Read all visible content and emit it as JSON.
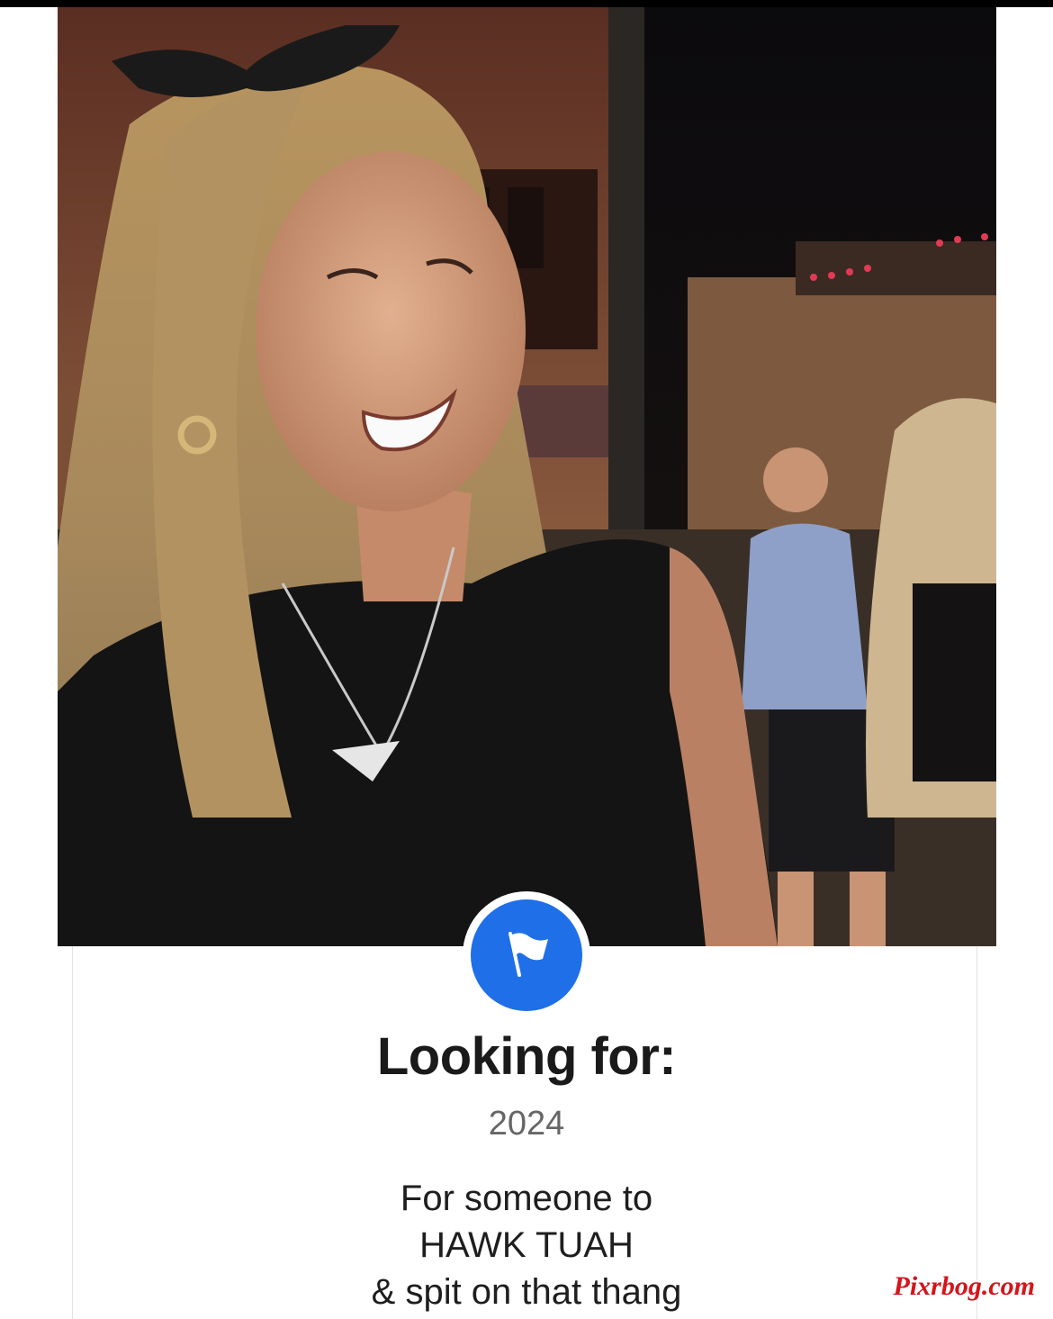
{
  "profile": {
    "section_title": "Looking for:",
    "year": "2024",
    "description_lines": [
      "For someone to",
      "HAWK TUAH",
      "& spit on that thang"
    ],
    "badge_icon": "flag-icon",
    "accent_color": "#1e6fe8"
  },
  "watermark": "Pixrbog.com"
}
